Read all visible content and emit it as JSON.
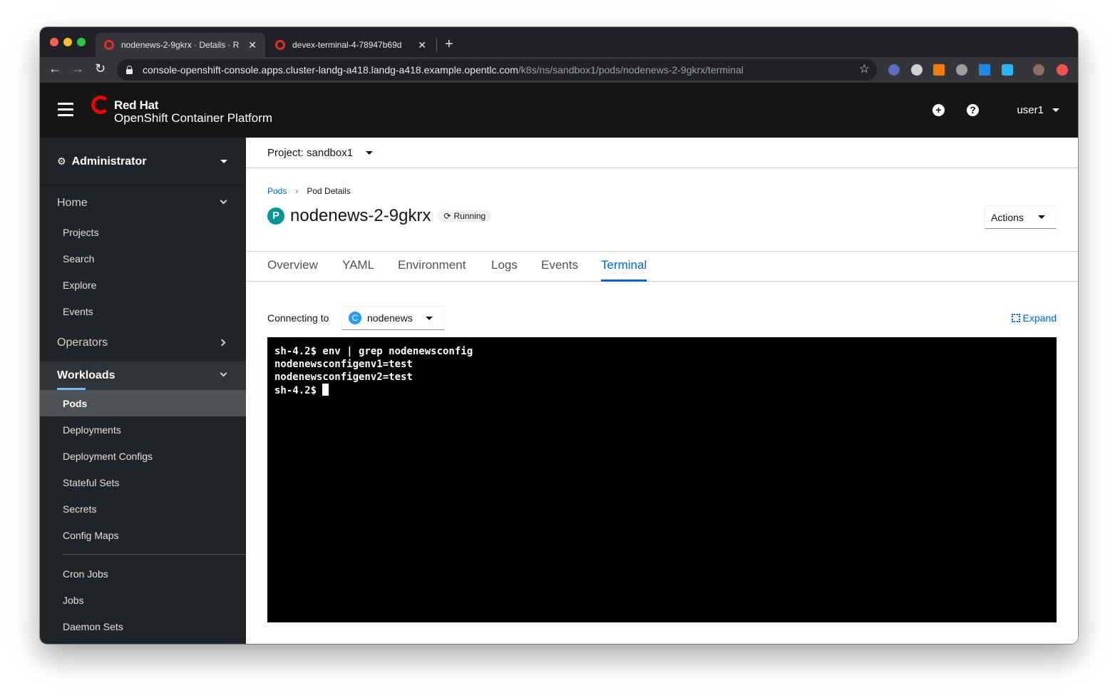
{
  "browser": {
    "tabs": [
      {
        "title": "nodenews-2-9gkrx · Details · R",
        "active": true
      },
      {
        "title": "devex-terminal-4-78947b69d",
        "active": false
      }
    ],
    "url_host": "console-openshift-console.apps.cluster-landg-a418.landg-a418.example.opentlc.com",
    "url_path": "/k8s/ns/sandbox1/pods/nodenews-2-9gkrx/terminal",
    "colors": {
      "traffic_red": "#ff5f57",
      "traffic_yellow": "#febc2e",
      "traffic_green": "#28c840"
    }
  },
  "masthead": {
    "brand_line1": "Red Hat",
    "brand_line2": "OpenShift Container Platform",
    "user": "user1",
    "icons": [
      "menu-icon",
      "plus-circle-icon",
      "question-circle-icon"
    ]
  },
  "sidebar": {
    "perspective": "Administrator",
    "home": {
      "label": "Home",
      "items": [
        "Projects",
        "Search",
        "Explore",
        "Events"
      ]
    },
    "operators": {
      "label": "Operators"
    },
    "workloads": {
      "label": "Workloads",
      "items": [
        "Pods",
        "Deployments",
        "Deployment Configs",
        "Stateful Sets",
        "Secrets",
        "Config Maps"
      ],
      "items2": [
        "Cron Jobs",
        "Jobs",
        "Daemon Sets"
      ]
    }
  },
  "main": {
    "project": "Project: sandbox1",
    "breadcrumb": {
      "link": "Pods",
      "current": "Pod Details"
    },
    "badge": "P",
    "title": "nodenews-2-9gkrx",
    "status": "Running",
    "actions": "Actions",
    "tabs": [
      "Overview",
      "YAML",
      "Environment",
      "Logs",
      "Events",
      "Terminal"
    ],
    "connecting_label": "Connecting to",
    "container_badge": "C",
    "container": "nodenews",
    "expand": "Expand",
    "terminal_lines": [
      "sh-4.2$ env | grep nodenewsconfig",
      "nodenewsconfigenv1=test",
      "nodenewsconfigenv2=test",
      "sh-4.2$ "
    ],
    "colors": {
      "link": "#0066cc",
      "pod_badge": "#009596",
      "container_badge": "#2b9af3"
    }
  }
}
